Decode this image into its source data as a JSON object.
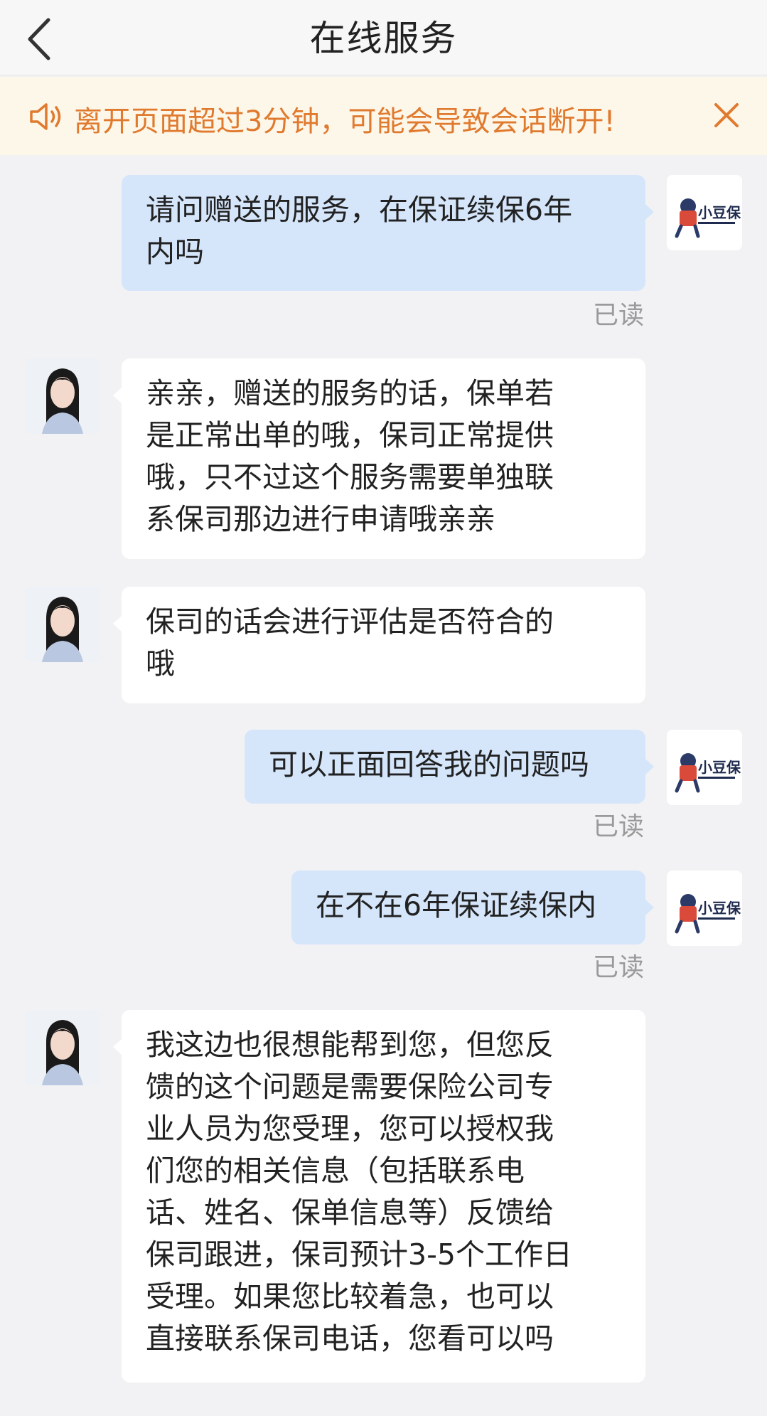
{
  "header": {
    "title": "在线服务",
    "back_icon": "chevron-left-icon"
  },
  "notice": {
    "text": "离开页面超过3分钟，可能会导致会话断开!",
    "color": "#e07a2e",
    "background": "#fdf7ea",
    "speaker_icon": "speaker-icon",
    "close_icon": "close-icon"
  },
  "user_avatar": {
    "brand": "小豆保"
  },
  "colors": {
    "user_bubble": "#d5e6fb",
    "agent_bubble": "#ffffff",
    "read_text": "#9a9a9a"
  },
  "messages": [
    {
      "sender": "user",
      "lines": [
        "请问赠送的服务，在保证续保6年",
        "内吗"
      ],
      "status": "已读"
    },
    {
      "sender": "agent",
      "lines": [
        "亲亲，赠送的服务的话，保单若",
        "是正常出单的哦，保司正常提供",
        "哦，只不过这个服务需要单独联",
        "系保司那边进行申请哦亲亲"
      ]
    },
    {
      "sender": "agent",
      "lines": [
        "保司的话会进行评估是否符合的",
        "哦"
      ]
    },
    {
      "sender": "user",
      "lines": [
        "可以正面回答我的问题吗"
      ],
      "status": "已读"
    },
    {
      "sender": "user",
      "lines": [
        "在不在6年保证续保内"
      ],
      "status": "已读"
    },
    {
      "sender": "agent",
      "lines": [
        "我这边也很想能帮到您，但您反",
        "馈的这个问题是需要保险公司专",
        "业人员为您受理，您可以授权我",
        "们您的相关信息（包括联系电",
        "话、姓名、保单信息等）反馈给",
        "保司跟进，保司预计3-5个工作日",
        "受理。如果您比较着急，也可以",
        "直接联系保司电话，您看可以吗"
      ]
    }
  ]
}
